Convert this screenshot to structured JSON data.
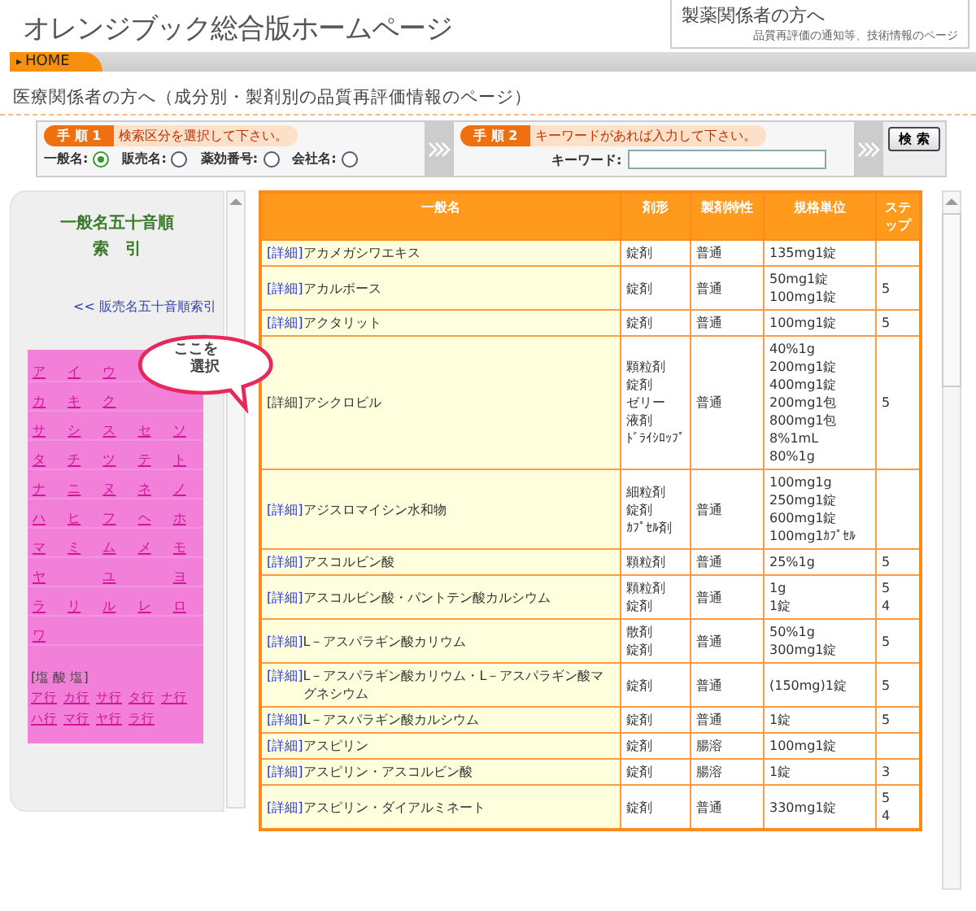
{
  "header": {
    "site_title": "オレンジブック総合版ホームページ",
    "side_box": {
      "title": "製薬関係者の方へ",
      "subtitle": "品質再評価の通知等、技術情報のページ"
    }
  },
  "breadcrumb": {
    "marker": "▸",
    "label": "HOME"
  },
  "page_heading": "医療関係者の方へ（成分別・製剤別の品質再評価情報のページ）",
  "search": {
    "step1": {
      "badge": "手 順 1",
      "instruction": "検索区分を選択して下さい。",
      "options": [
        {
          "label": "一般名:",
          "selected": true
        },
        {
          "label": "販売名:",
          "selected": false
        },
        {
          "label": "薬効番号:",
          "selected": false
        },
        {
          "label": "会社名:",
          "selected": false
        }
      ]
    },
    "step2": {
      "badge": "手 順 2",
      "instruction": "キーワードがあれば入力して下さい。",
      "field_label": "キーワード:"
    },
    "button": "検 索"
  },
  "sidebar": {
    "title": [
      "一般名五十音順",
      "索　引"
    ],
    "switch_link": "<< 販売名五十音順索引",
    "kana_rows": [
      [
        "ア",
        "イ",
        "ウ",
        null,
        null
      ],
      [
        "カ",
        "キ",
        "ク",
        null,
        null
      ],
      [
        "サ",
        "シ",
        "ス",
        "セ",
        "ソ"
      ],
      [
        "タ",
        "チ",
        "ツ",
        "テ",
        "ト"
      ],
      [
        "ナ",
        "ニ",
        "ヌ",
        "ネ",
        "ノ"
      ],
      [
        "ハ",
        "ヒ",
        "フ",
        "ヘ",
        "ホ"
      ],
      [
        "マ",
        "ミ",
        "ム",
        "メ",
        "モ"
      ],
      [
        "ヤ",
        null,
        "ユ",
        null,
        "ヨ"
      ],
      [
        "ラ",
        "リ",
        "ル",
        "レ",
        "ロ"
      ],
      [
        "ワ",
        null,
        null,
        null,
        null
      ]
    ],
    "salt_heading": "[塩 酸 塩]",
    "salt_links": [
      "ア行",
      "カ行",
      "サ行",
      "タ行",
      "ナ行",
      "ハ行",
      "マ行",
      "ヤ行",
      "ラ行"
    ],
    "callout": [
      "ここを",
      "選択"
    ]
  },
  "table": {
    "columns": [
      "一般名",
      "剤形",
      "製剤特性",
      "規格単位",
      "ステップ"
    ],
    "rows": [
      {
        "detail": "[詳細]",
        "visited": false,
        "name": "アカメガシワエキス",
        "form": [
          "錠剤"
        ],
        "property": "普通",
        "unit": [
          "135mg1錠"
        ]
      },
      {
        "detail": "[詳細]",
        "visited": false,
        "name": "アカルボース",
        "form": [
          "錠剤"
        ],
        "property": "普通",
        "unit": [
          "50mg1錠",
          "100mg1錠"
        ],
        "step": [
          "5"
        ]
      },
      {
        "detail": "[詳細]",
        "visited": false,
        "name": "アクタリット",
        "form": [
          "錠剤"
        ],
        "property": "普通",
        "unit": [
          "100mg1錠"
        ],
        "step": [
          "5"
        ]
      },
      {
        "detail": "[詳細]",
        "visited": true,
        "name": "アシクロビル",
        "form": [
          "顆粒剤",
          "錠剤",
          "ゼリー",
          "液剤",
          "ﾄﾞﾗｲｼﾛｯﾌﾟ"
        ],
        "property": "普通",
        "unit": [
          "40%1g",
          "200mg1錠",
          "400mg1錠",
          "200mg1包",
          "800mg1包",
          "8%1mL",
          "80%1g"
        ],
        "step": [
          "5"
        ]
      },
      {
        "detail": "[詳細]",
        "visited": false,
        "name": "アジスロマイシン水和物",
        "form": [
          "細粒剤",
          "錠剤",
          "ｶﾌﾟｾﾙ剤"
        ],
        "property": "普通",
        "unit": [
          "100mg1g",
          "250mg1錠",
          "600mg1錠",
          "100mg1ｶﾌﾟｾﾙ"
        ]
      },
      {
        "detail": "[詳細]",
        "visited": false,
        "name": "アスコルビン酸",
        "form": [
          "顆粒剤"
        ],
        "property": "普通",
        "unit": [
          "25%1g"
        ],
        "step": [
          "5"
        ]
      },
      {
        "detail": "[詳細]",
        "visited": false,
        "name": "アスコルビン酸・パントテン酸カルシウム",
        "form": [
          "顆粒剤",
          "錠剤"
        ],
        "property": "普通",
        "unit": [
          "1g",
          "1錠"
        ],
        "step": [
          "5",
          "4"
        ]
      },
      {
        "detail": "[詳細]",
        "visited": false,
        "name": "L－アスパラギン酸カリウム",
        "form": [
          "散剤",
          "錠剤"
        ],
        "property": "普通",
        "unit": [
          "50%1g",
          "300mg1錠"
        ],
        "step": [
          "5"
        ]
      },
      {
        "detail": "[詳細]",
        "visited": false,
        "name": "L－アスパラギン酸カリウム・L－アスパラギン酸マグネシウム",
        "form": [
          "錠剤"
        ],
        "property": "普通",
        "unit": [
          "(150mg)1錠"
        ],
        "step": [
          "5"
        ]
      },
      {
        "detail": "[詳細]",
        "visited": false,
        "name": "L－アスパラギン酸カルシウム",
        "form": [
          "錠剤"
        ],
        "property": "普通",
        "unit": [
          "1錠"
        ],
        "step": [
          "5"
        ]
      },
      {
        "detail": "[詳細]",
        "visited": false,
        "name": "アスピリン",
        "form": [
          "錠剤"
        ],
        "property": "腸溶",
        "unit": [
          "100mg1錠"
        ]
      },
      {
        "detail": "[詳細]",
        "visited": false,
        "name": "アスピリン・アスコルビン酸",
        "form": [
          "錠剤"
        ],
        "property": "腸溶",
        "unit": [
          "1錠"
        ],
        "step": [
          "3"
        ]
      },
      {
        "detail": "[詳細]",
        "visited": false,
        "name": "アスピリン・ダイアルミネート",
        "form": [
          "錠剤"
        ],
        "property": "普通",
        "unit": [
          "330mg1錠"
        ],
        "step": [
          "5",
          "4"
        ]
      }
    ]
  }
}
